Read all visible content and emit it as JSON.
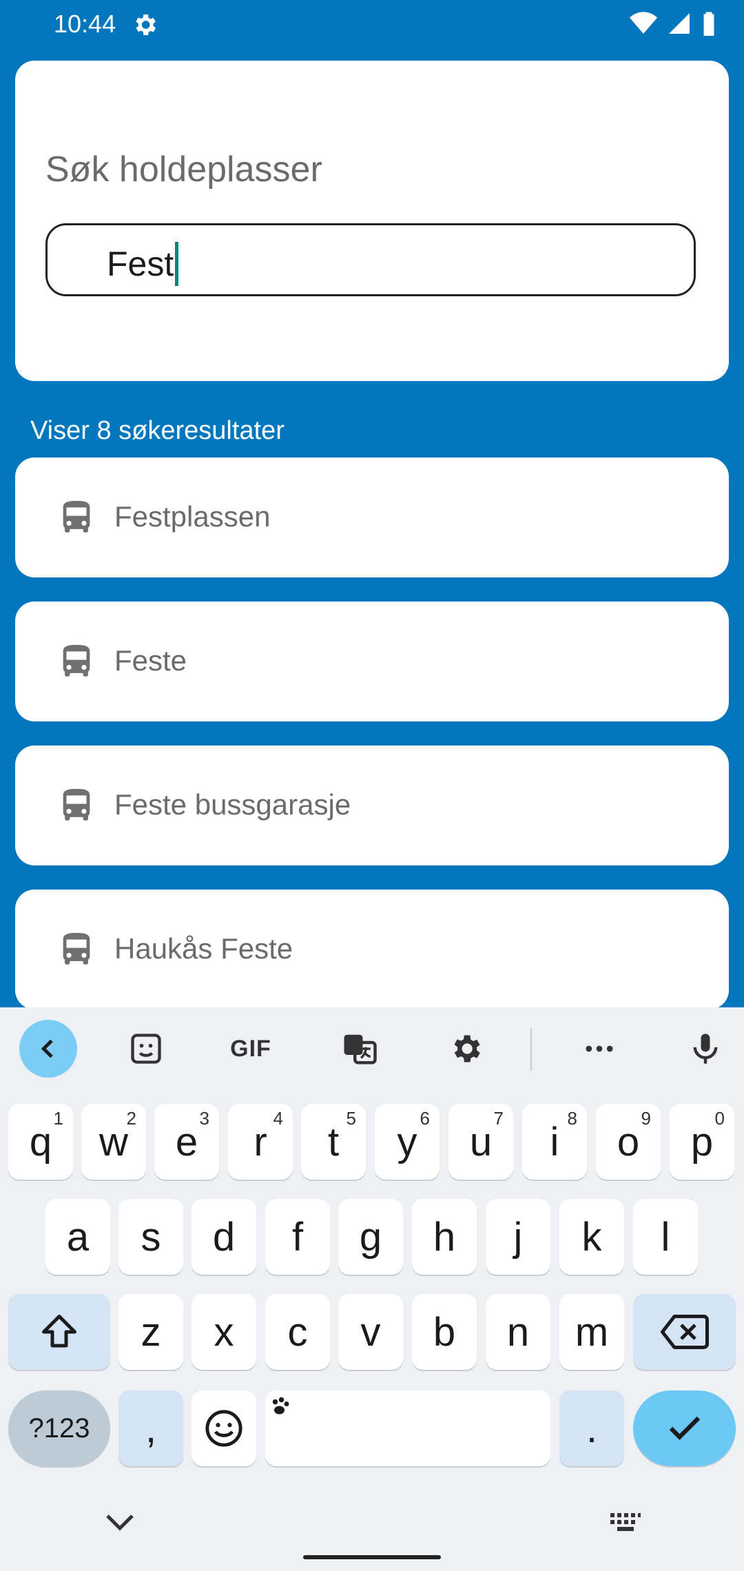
{
  "status_bar": {
    "time": "10:44"
  },
  "search": {
    "title": "Søk holdeplasser",
    "value": "Fest"
  },
  "results": {
    "count_text": "Viser 8 søkeresultater",
    "items": [
      {
        "label": "Festplassen",
        "icon": "bus-icon"
      },
      {
        "label": "Feste",
        "icon": "bus-icon"
      },
      {
        "label": "Feste bussgarasje",
        "icon": "bus-icon"
      },
      {
        "label": "Haukås Feste",
        "icon": "bus-icon"
      }
    ]
  },
  "keyboard": {
    "row1": [
      {
        "k": "q",
        "h": "1"
      },
      {
        "k": "w",
        "h": "2"
      },
      {
        "k": "e",
        "h": "3"
      },
      {
        "k": "r",
        "h": "4"
      },
      {
        "k": "t",
        "h": "5"
      },
      {
        "k": "y",
        "h": "6"
      },
      {
        "k": "u",
        "h": "7"
      },
      {
        "k": "i",
        "h": "8"
      },
      {
        "k": "o",
        "h": "9"
      },
      {
        "k": "p",
        "h": "0"
      }
    ],
    "row2": [
      "a",
      "s",
      "d",
      "f",
      "g",
      "h",
      "j",
      "k",
      "l"
    ],
    "row3": [
      "z",
      "x",
      "c",
      "v",
      "b",
      "n",
      "m"
    ],
    "numbers_label": "?123",
    "comma": ",",
    "period": ".",
    "gif_label": "GIF"
  },
  "colors": {
    "background": "#0277BD",
    "accent": "#6CC9F5"
  }
}
